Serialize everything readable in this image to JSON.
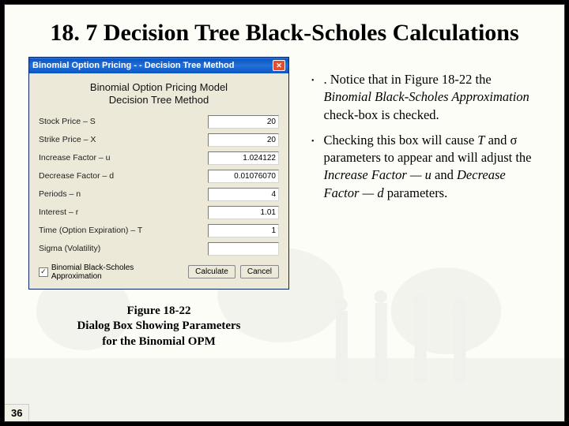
{
  "title": "18. 7 Decision Tree Black-Scholes Calculations",
  "dialog": {
    "titlebar": "Binomial Option Pricing - - Decision Tree Method",
    "heading_l1": "Binomial Option Pricing Model",
    "heading_l2": "Decision Tree Method",
    "fields": [
      {
        "label": "Stock Price – S",
        "value": "20"
      },
      {
        "label": "Strike Price – X",
        "value": "20"
      },
      {
        "label": "Increase Factor – u",
        "value": "1.024122"
      },
      {
        "label": "Decrease Factor – d",
        "value": "0.01076070"
      },
      {
        "label": "Periods – n",
        "value": "4"
      },
      {
        "label": "Interest – r",
        "value": "1.01"
      },
      {
        "label": "Time (Option Expiration) – T",
        "value": "1"
      },
      {
        "label": "Sigma (Volatility)",
        "value": ""
      }
    ],
    "checkbox_label": "Binomial Black-Scholes Approximation",
    "checkbox_checked": "✓",
    "btn_calculate": "Calculate",
    "btn_cancel": "Cancel"
  },
  "caption_l1": "Figure 18-22",
  "caption_l2": "Dialog Box Showing Parameters",
  "caption_l3": "for the Binomial OPM",
  "bullets": {
    "b1_pre": ". Notice that in Figure 18-22 the ",
    "b1_italic": "Binomial Black-Scholes Approximation",
    "b1_post": " check-box is checked.",
    "b2_pre": "Checking this box will cause ",
    "b2_T": "T",
    "b2_mid1": " and σ parameters to appear and will adjust the ",
    "b2_it1": "Increase Factor — u",
    "b2_mid2": " and ",
    "b2_it2": "Decrease Factor — d",
    "b2_post": " parameters."
  },
  "page_number": "36"
}
